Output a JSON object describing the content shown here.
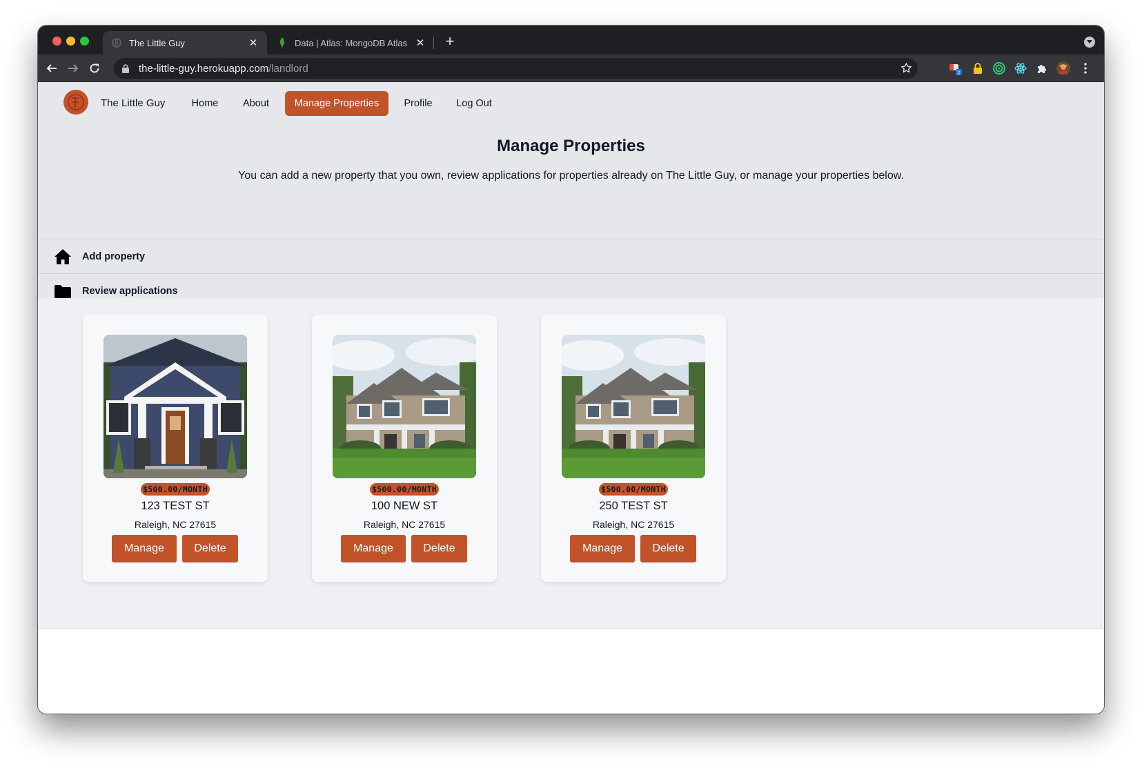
{
  "browser": {
    "tabs": [
      {
        "title": "The Little Guy",
        "active": true
      },
      {
        "title": "Data | Atlas: MongoDB Atlas",
        "active": false
      }
    ],
    "url_host": "the-little-guy.herokuapp.com",
    "url_path": "/landlord"
  },
  "colors": {
    "accent": "#c2522a",
    "navbar_bg": "#e5e7eb",
    "cards_bg": "#eef0f3"
  },
  "navbar": {
    "brand": "The Little Guy",
    "links": [
      {
        "label": "Home",
        "active": false
      },
      {
        "label": "About",
        "active": false
      },
      {
        "label": "Manage Properties",
        "active": true
      },
      {
        "label": "Profile",
        "active": false
      },
      {
        "label": "Log Out",
        "active": false
      }
    ]
  },
  "main": {
    "title": "Manage Properties",
    "subtitle": "You can add a new property that you own, review applications for properties already on The Little Guy, or manage your properties below.",
    "sections": [
      {
        "label": "Add property",
        "icon": "home-icon"
      },
      {
        "label": "Review applications",
        "icon": "folder-icon"
      }
    ]
  },
  "properties": [
    {
      "price": "$500.00/MONTH",
      "street": "123 TEST ST",
      "city": "Raleigh, NC 27615",
      "image": "craftsman-house-photo",
      "manage_label": "Manage",
      "delete_label": "Delete"
    },
    {
      "price": "$500.00/MONTH",
      "street": "100 NEW ST",
      "city": "Raleigh, NC 27615",
      "image": "two-story-house-photo",
      "manage_label": "Manage",
      "delete_label": "Delete"
    },
    {
      "price": "$500.00/MONTH",
      "street": "250 TEST ST",
      "city": "Raleigh, NC 27615",
      "image": "two-story-house-photo",
      "manage_label": "Manage",
      "delete_label": "Delete"
    }
  ]
}
